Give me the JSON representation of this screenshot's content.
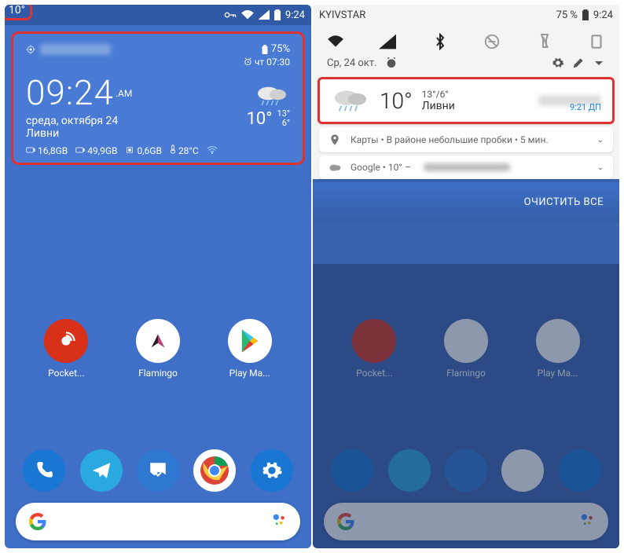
{
  "left": {
    "status": {
      "temp_badge": "10°",
      "battery": "9:24"
    },
    "widget": {
      "battery": "75%",
      "alarm": "чт 07:30",
      "clock": "09:24",
      "ampm": ".AM",
      "date": "среда, октября 24",
      "condition": "Ливни",
      "temp": "10°",
      "hi": "13°",
      "lo": "6°",
      "ram": "16,8GB",
      "storage": "49,9GB",
      "cache": "0,6GB",
      "cpu_temp": "28°C"
    },
    "apps": [
      {
        "label": "Pocket..."
      },
      {
        "label": "Flamingo"
      },
      {
        "label": "Play Ма..."
      }
    ]
  },
  "right": {
    "status": {
      "carrier": "KYIVSTAR",
      "batt_pct": "75 %",
      "clock": "9:24"
    },
    "qs_sub": {
      "date": "Ср, 24 окт."
    },
    "weather_notif": {
      "temp": "10°",
      "range": "13°/6°",
      "condition": "Ливни",
      "time": "9:21 ДП"
    },
    "maps_notif": "Карты • В районе небольшие пробки • 5 мин.",
    "google_notif": "Google • 10° –",
    "clear_all": "ОЧИСТИТЬ ВСЕ",
    "apps": [
      {
        "label": "Pocket..."
      },
      {
        "label": "Flamingo"
      },
      {
        "label": "Play Ма..."
      }
    ]
  }
}
